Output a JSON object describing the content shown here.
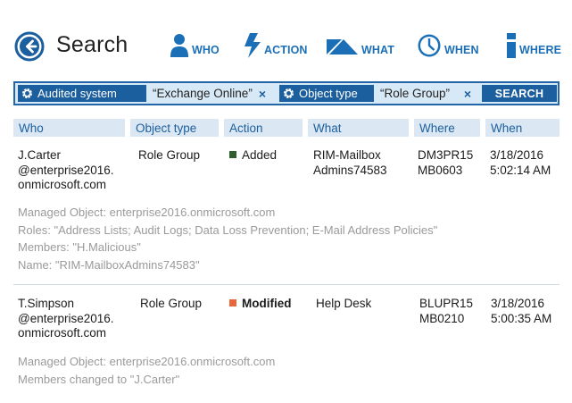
{
  "header": {
    "title": "Search",
    "nav": [
      {
        "label": "WHO",
        "icon": "person-icon"
      },
      {
        "label": "ACTION",
        "icon": "lightning-icon"
      },
      {
        "label": "WHAT",
        "icon": "shapes-icon"
      },
      {
        "label": "WHEN",
        "icon": "clock-icon"
      },
      {
        "label": "WHERE",
        "icon": "location-marker-icon"
      }
    ]
  },
  "search": {
    "filters": [
      {
        "label": "Audited system",
        "value": "“Exchange Online”",
        "remove": "×",
        "icon": "gear-icon"
      },
      {
        "label": "Object type",
        "value": "“Role Group”",
        "remove": "×",
        "icon": "gear-icon"
      }
    ],
    "button": "SEARCH"
  },
  "table": {
    "columns": [
      "Who",
      "Object type",
      "Action",
      "What",
      "Where",
      "When"
    ],
    "rows": [
      {
        "who": [
          "J.Carter",
          "@enterprise2016.",
          "onmicrosoft.com"
        ],
        "object_type": "Role Group",
        "action": "Added",
        "action_color": "#2e5e2e",
        "what": [
          "RIM-Mailbox",
          "Admins74583"
        ],
        "where": [
          "DM3PR15",
          "MB0603"
        ],
        "when": [
          "3/18/2016",
          "5:02:14 AM"
        ],
        "details": [
          "Managed Object: enterprise2016.onmicrosoft.com",
          "Roles: \"Address Lists; Audit Logs; Data Loss Prevention; E-Mail Address Policies\"",
          "Members: \"H.Malicious\"",
          "Name: \"RIM-MailboxAdmins74583\""
        ]
      },
      {
        "who": [
          "T.Simpson",
          "@enterprise2016.",
          "onmicrosoft.com"
        ],
        "object_type": "Role Group",
        "action": "Modified",
        "action_color": "#e8673a",
        "what": [
          "Help Desk"
        ],
        "where": [
          "BLUPR15",
          "MB0210"
        ],
        "when": [
          "3/18/2016",
          "5:00:35 AM"
        ],
        "details": [
          "Managed Object: enterprise2016.onmicrosoft.com",
          "Members changed to \"J.Carter\""
        ]
      }
    ]
  },
  "colors": {
    "accent": "#1c5f9e",
    "nav": "#1a6fb7",
    "header_bg": "#dbe8f4",
    "muted_text": "#9a9a9a"
  }
}
